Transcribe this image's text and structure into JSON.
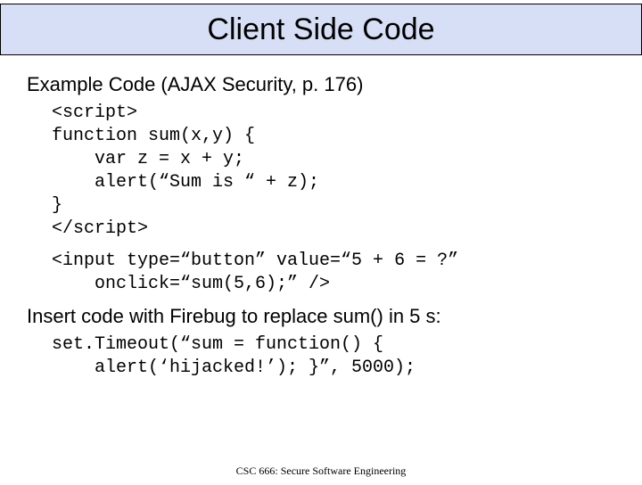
{
  "title": "Client Side Code",
  "heading1": "Example Code (AJAX Security, p. 176)",
  "code1": "<script>\nfunction sum(x,y) {\n    var z = x + y;\n    alert(“Sum is “ + z);\n}\n</script>",
  "code1b_l1": "<input type=“button” value=“5 + 6 = ?”",
  "code1b_l2": "  onclick=“sum(5,6);” />",
  "heading2": "Insert code with Firebug to replace sum() in 5 s:",
  "code2_l1": "set.Timeout(“sum = function() {",
  "code2_l2": "  alert(‘hijacked!’); }”, 5000);",
  "footer": "CSC 666: Secure Software Engineering"
}
